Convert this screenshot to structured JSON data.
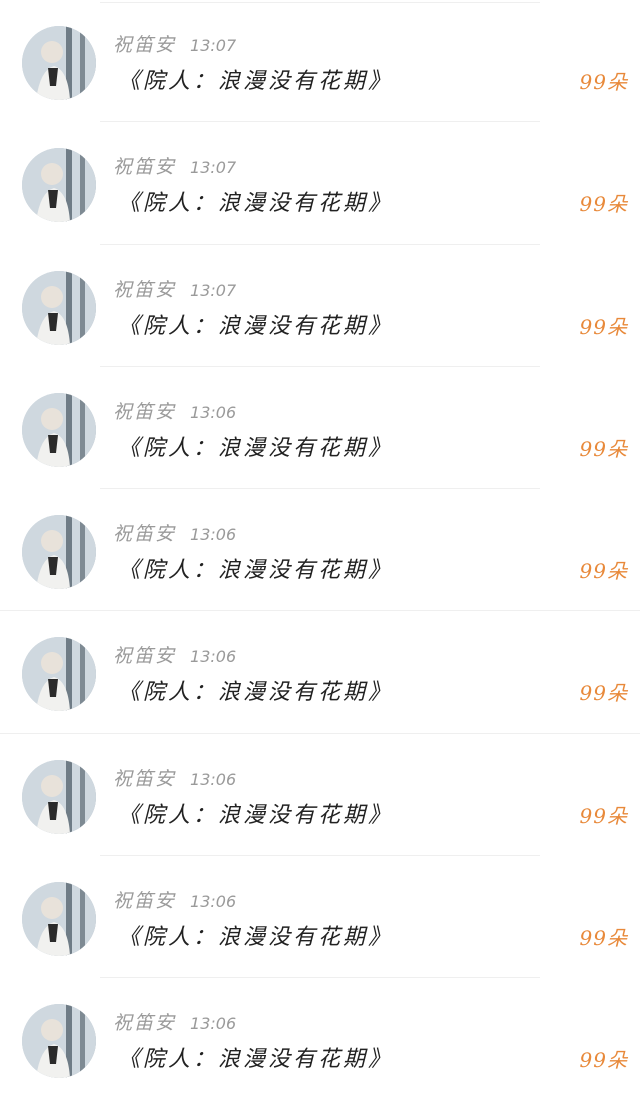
{
  "messages": [
    {
      "name": "祝笛安",
      "time": "13:07",
      "text": "《院人：浪漫没有花期》",
      "count": "99朵",
      "avatar": "avatar-photo"
    },
    {
      "name": "祝笛安",
      "time": "13:07",
      "text": "《院人：浪漫没有花期》",
      "count": "99朵",
      "avatar": "avatar-photo"
    },
    {
      "name": "祝笛安",
      "time": "13:07",
      "text": "《院人：浪漫没有花期》",
      "count": "99朵",
      "avatar": "avatar-photo"
    },
    {
      "name": "祝笛安",
      "time": "13:06",
      "text": "《院人：浪漫没有花期》",
      "count": "99朵",
      "avatar": "avatar-photo"
    },
    {
      "name": "祝笛安",
      "time": "13:06",
      "text": "《院人：浪漫没有花期》",
      "count": "99朵",
      "avatar": "avatar-photo"
    },
    {
      "name": "祝笛安",
      "time": "13:06",
      "text": "《院人：浪漫没有花期》",
      "count": "99朵",
      "avatar": "avatar-photo"
    },
    {
      "name": "祝笛安",
      "time": "13:06",
      "text": "《院人：浪漫没有花期》",
      "count": "99朵",
      "avatar": "avatar-photo"
    },
    {
      "name": "祝笛安",
      "time": "13:06",
      "text": "《院人：浪漫没有花期》",
      "count": "99朵",
      "avatar": "avatar-photo"
    },
    {
      "name": "祝笛安",
      "time": "13:06",
      "text": "《院人：浪漫没有花期》",
      "count": "99朵",
      "avatar": "avatar-photo"
    }
  ],
  "colors": {
    "name": "#9a9a9a",
    "message": "#222222",
    "count": "#e8893a",
    "divider": "#efefef"
  }
}
